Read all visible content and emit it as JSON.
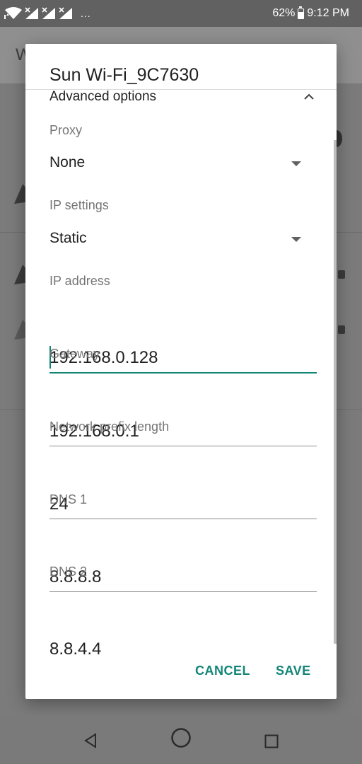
{
  "status_bar": {
    "battery": "62%",
    "time": "9:12 PM",
    "more": "...",
    "icons": [
      "wifi-icon",
      "signal-icon",
      "signal-icon",
      "signal-icon",
      "battery-icon"
    ]
  },
  "dialog": {
    "title": "Sun Wi-Fi_9C7630",
    "advanced_options": "Advanced options",
    "proxy": {
      "label": "Proxy",
      "value": "None"
    },
    "ip_settings": {
      "label": "IP settings",
      "value": "Static"
    },
    "ip_address": {
      "label": "IP address",
      "value": "192.168.0.128"
    },
    "gateway": {
      "label": "Gateway",
      "value": "192.168.0.1"
    },
    "prefix_length": {
      "label": "Network prefix length",
      "value": "24"
    },
    "dns1": {
      "label": "DNS 1",
      "value": "8.8.8.8"
    },
    "dns2": {
      "label": "DNS 2",
      "value": "8.8.4.4"
    },
    "cancel_label": "CANCEL",
    "save_label": "SAVE"
  },
  "background": {
    "title_initial": "W"
  },
  "colors": {
    "accent": "#138577",
    "text_primary": "#212121",
    "text_secondary": "#757575"
  },
  "nav_bar": {
    "icons": [
      "back-icon",
      "home-icon",
      "recents-icon"
    ]
  }
}
